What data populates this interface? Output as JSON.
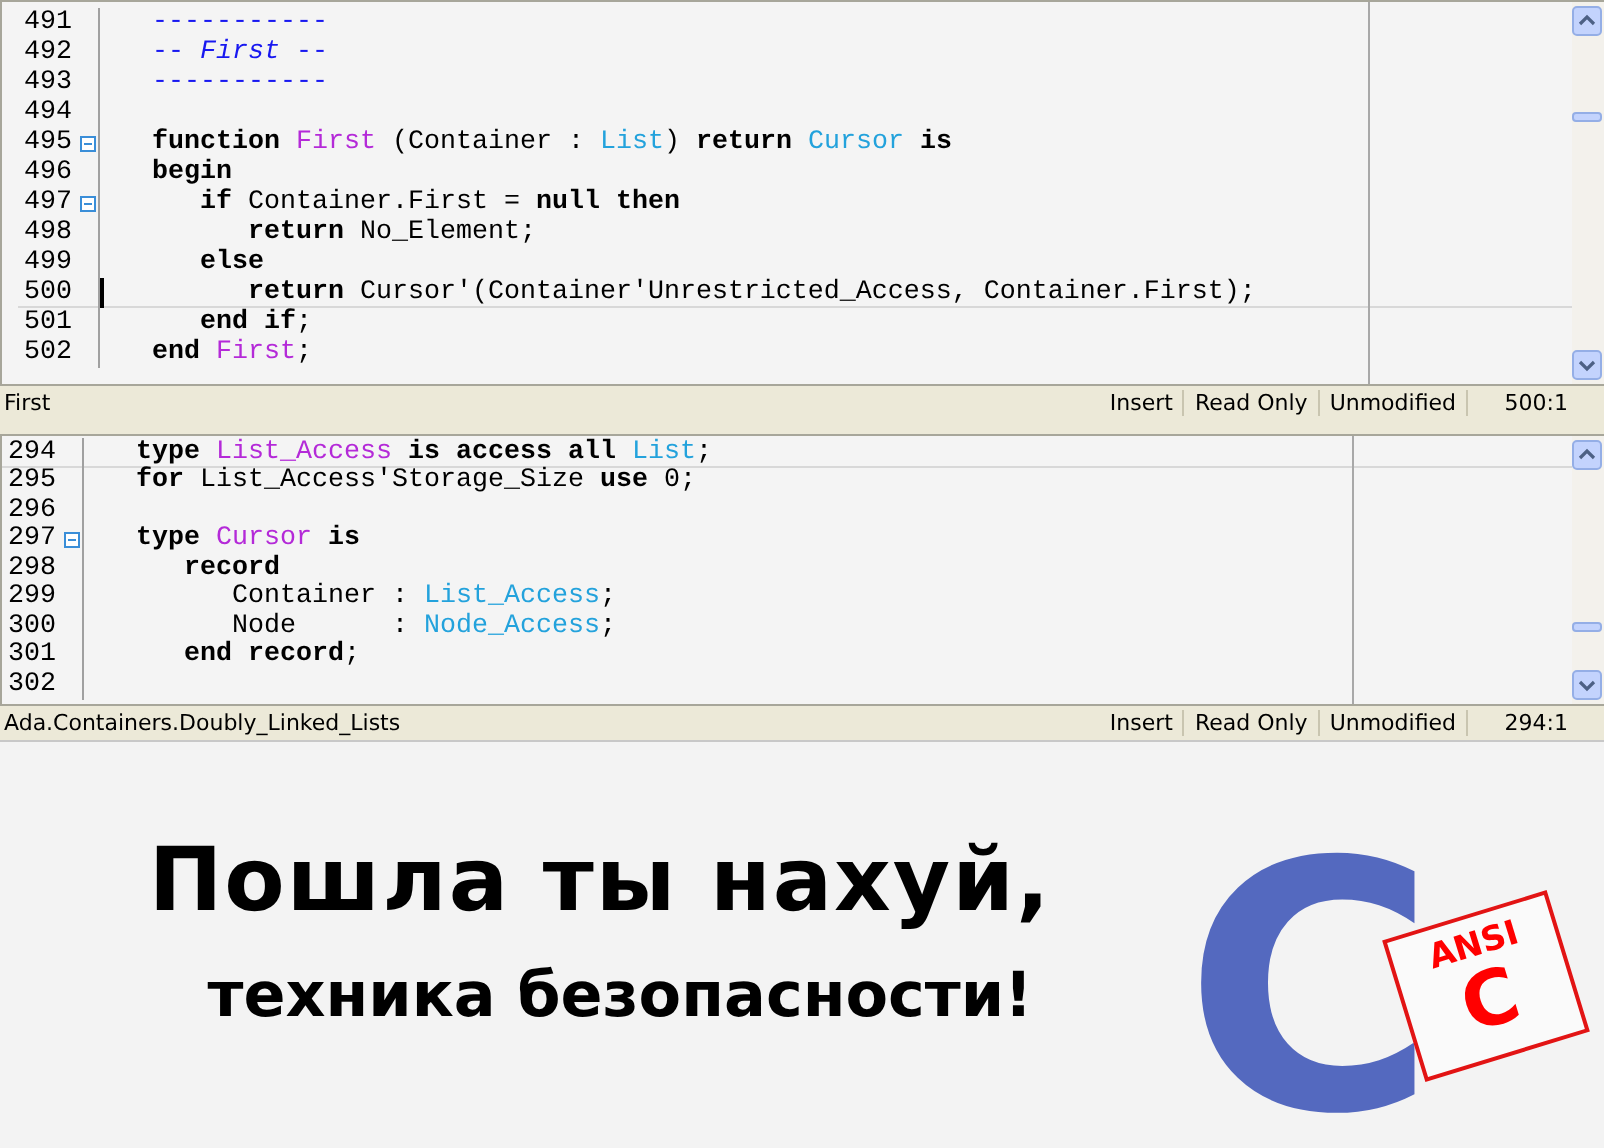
{
  "panes": [
    {
      "lines": [
        {
          "number": "491",
          "fold": false,
          "current": false,
          "caret": false,
          "tokens": [
            {
              "kind": "comment",
              "text": "   -----------"
            }
          ]
        },
        {
          "number": "492",
          "fold": false,
          "current": false,
          "caret": false,
          "tokens": [
            {
              "kind": "comment",
              "text": "   -- "
            },
            {
              "kind": "comment_em",
              "text": "First"
            },
            {
              "kind": "comment",
              "text": " --"
            }
          ]
        },
        {
          "number": "493",
          "fold": false,
          "current": false,
          "caret": false,
          "tokens": [
            {
              "kind": "comment",
              "text": "   -----------"
            }
          ]
        },
        {
          "number": "494",
          "fold": false,
          "current": false,
          "caret": false
        },
        {
          "number": "495",
          "fold": true,
          "current": false,
          "caret": false,
          "tokens": [
            {
              "kind": "keyword",
              "text": "   function "
            },
            {
              "kind": "entity",
              "text": "First"
            },
            {
              "kind": "plain",
              "text": " (Container : "
            },
            {
              "kind": "type",
              "text": "List"
            },
            {
              "kind": "plain",
              "text": ") "
            },
            {
              "kind": "keyword",
              "text": "return "
            },
            {
              "kind": "type",
              "text": "Cursor"
            },
            {
              "kind": "keyword",
              "text": " is"
            }
          ]
        },
        {
          "number": "496",
          "fold": false,
          "current": false,
          "caret": false,
          "tokens": [
            {
              "kind": "keyword",
              "text": "   begin"
            }
          ]
        },
        {
          "number": "497",
          "fold": true,
          "current": false,
          "caret": false,
          "tokens": [
            {
              "kind": "keyword",
              "text": "      if"
            },
            {
              "kind": "plain",
              "text": " Container.First = "
            },
            {
              "kind": "keyword",
              "text": "null then"
            }
          ]
        },
        {
          "number": "498",
          "fold": false,
          "current": false,
          "caret": false,
          "tokens": [
            {
              "kind": "keyword",
              "text": "         return"
            },
            {
              "kind": "plain",
              "text": " No_Element;"
            }
          ]
        },
        {
          "number": "499",
          "fold": false,
          "current": false,
          "caret": false,
          "tokens": [
            {
              "kind": "keyword",
              "text": "      else"
            }
          ]
        },
        {
          "number": "500",
          "fold": false,
          "current": true,
          "caret": true,
          "tokens": [
            {
              "kind": "keyword",
              "text": "         return"
            },
            {
              "kind": "plain",
              "text": " Cursor'(Container'Unrestricted_Access, Container.First);"
            }
          ]
        },
        {
          "number": "501",
          "fold": false,
          "current": false,
          "caret": false,
          "tokens": [
            {
              "kind": "keyword",
              "text": "      end if"
            },
            {
              "kind": "plain",
              "text": ";"
            }
          ]
        },
        {
          "number": "502",
          "fold": false,
          "current": false,
          "caret": false,
          "tokens": [
            {
              "kind": "keyword",
              "text": "   end "
            },
            {
              "kind": "entity",
              "text": "First"
            },
            {
              "kind": "plain",
              "text": ";"
            }
          ]
        }
      ],
      "status": {
        "context": "First",
        "mode": "Insert",
        "access": "Read Only",
        "modified": "Unmodified",
        "position": "500:1"
      }
    },
    {
      "lines": [
        {
          "number": "294",
          "fold": false,
          "current": true,
          "caret": false,
          "tokens": [
            {
              "kind": "keyword",
              "text": "   type "
            },
            {
              "kind": "entity",
              "text": "List_Access"
            },
            {
              "kind": "keyword",
              "text": " is access all "
            },
            {
              "kind": "type",
              "text": "List"
            },
            {
              "kind": "plain",
              "text": ";"
            }
          ]
        },
        {
          "number": "295",
          "fold": false,
          "current": false,
          "caret": false,
          "tokens": [
            {
              "kind": "keyword",
              "text": "   for"
            },
            {
              "kind": "plain",
              "text": " List_Access'Storage_Size "
            },
            {
              "kind": "keyword",
              "text": "use"
            },
            {
              "kind": "plain",
              "text": " 0;"
            }
          ]
        },
        {
          "number": "296",
          "fold": false,
          "current": false,
          "caret": false
        },
        {
          "number": "297",
          "fold": true,
          "current": false,
          "caret": false,
          "tokens": [
            {
              "kind": "keyword",
              "text": "   type "
            },
            {
              "kind": "entity",
              "text": "Cursor"
            },
            {
              "kind": "keyword",
              "text": " is"
            }
          ]
        },
        {
          "number": "298",
          "fold": false,
          "current": false,
          "caret": false,
          "tokens": [
            {
              "kind": "keyword",
              "text": "      record"
            }
          ]
        },
        {
          "number": "299",
          "fold": false,
          "current": false,
          "caret": false,
          "tokens": [
            {
              "kind": "plain",
              "text": "         Container : "
            },
            {
              "kind": "type",
              "text": "List_Access"
            },
            {
              "kind": "plain",
              "text": ";"
            }
          ]
        },
        {
          "number": "300",
          "fold": false,
          "current": false,
          "caret": false,
          "tokens": [
            {
              "kind": "plain",
              "text": "         Node      : "
            },
            {
              "kind": "type",
              "text": "Node_Access"
            },
            {
              "kind": "plain",
              "text": ";"
            }
          ]
        },
        {
          "number": "301",
          "fold": false,
          "current": false,
          "caret": false,
          "tokens": [
            {
              "kind": "keyword",
              "text": "      end record"
            },
            {
              "kind": "plain",
              "text": ";"
            }
          ]
        },
        {
          "number": "302",
          "fold": false,
          "current": false,
          "caret": false
        }
      ],
      "status": {
        "context": "Ada.Containers.Doubly_Linked_Lists",
        "mode": "Insert",
        "access": "Read Only",
        "modified": "Unmodified",
        "position": "294:1"
      }
    }
  ],
  "caption": {
    "line_1": "Пошла ты нахуй,",
    "line_2": "техника безопасности!"
  },
  "logo": {
    "letter": "C",
    "stamp_label": "ANSI",
    "stamp_letter": "C"
  }
}
